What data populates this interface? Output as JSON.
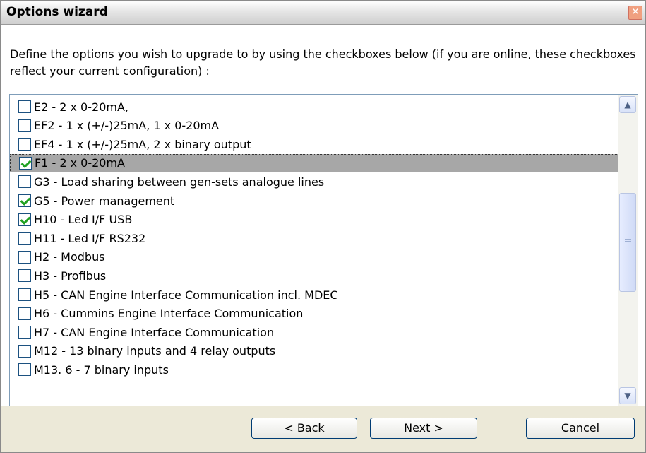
{
  "window": {
    "title": "Options wizard",
    "close_symbol": "✕"
  },
  "description": "Define the options you wish to upgrade to by using the checkboxes below (if you are online, these checkboxes reflect your current configuration) :",
  "options": [
    {
      "label": "E2 - 2 x 0-20mA,",
      "checked": false
    },
    {
      "label": "EF2 - 1 x (+/-)25mA, 1 x 0-20mA",
      "checked": false
    },
    {
      "label": "EF4 - 1 x (+/-)25mA, 2 x binary output",
      "checked": false
    },
    {
      "label": "F1 - 2 x 0-20mA",
      "checked": true,
      "selected": true
    },
    {
      "label": "G3 - Load sharing between gen-sets  analogue lines",
      "checked": false
    },
    {
      "label": "G5 - Power management",
      "checked": true
    },
    {
      "label": "H10 - Led I/F USB",
      "checked": true
    },
    {
      "label": "H11 - Led I/F RS232",
      "checked": false
    },
    {
      "label": "H2 - Modbus",
      "checked": false
    },
    {
      "label": "H3 - Profibus",
      "checked": false
    },
    {
      "label": "H5 - CAN Engine Interface Communication incl. MDEC",
      "checked": false
    },
    {
      "label": "H6 - Cummins Engine Interface Communication",
      "checked": false
    },
    {
      "label": "H7 - CAN Engine Interface Communication",
      "checked": false
    },
    {
      "label": "M12 - 13 binary inputs and 4 relay outputs",
      "checked": false
    },
    {
      "label": "M13. 6 - 7 binary inputs",
      "checked": false
    }
  ],
  "buttons": {
    "back": "< Back",
    "next": "Next >",
    "cancel": "Cancel"
  },
  "scrollbar": {
    "up_symbol": "▲",
    "down_symbol": "▼"
  },
  "colors": {
    "check": "#21a121",
    "selection": "#a7a7a7",
    "button_border": "#003c74"
  }
}
